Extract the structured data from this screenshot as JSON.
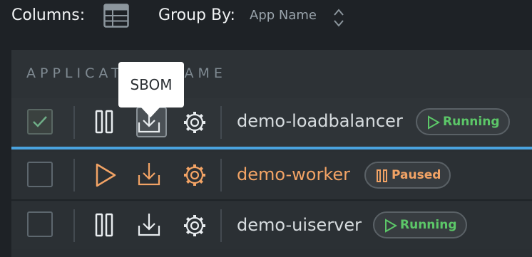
{
  "toolbar": {
    "columns_label": "Columns:",
    "columns_icon": "table-columns-icon",
    "group_by_label": "Group By:",
    "group_by_value": "App Name",
    "group_by_icon": "sort-updown-icon"
  },
  "table": {
    "header_label": "APPLICATION NAME",
    "rows": [
      {
        "name": "demo-loadbalancer",
        "checked": true,
        "action_icon": "pause-icon",
        "status": "Running",
        "status_icon": "play-icon",
        "status_color": "#5cc768",
        "name_color": "#d7dcdf"
      },
      {
        "name": "demo-worker",
        "checked": false,
        "action_icon": "play-icon",
        "status": "Paused",
        "status_icon": "pause-icon",
        "status_color": "#f2a365",
        "name_color": "#f2a365"
      },
      {
        "name": "demo-uiserver",
        "checked": false,
        "action_icon": "pause-icon",
        "status": "Running",
        "status_icon": "play-icon",
        "status_color": "#5cc768",
        "name_color": "#d7dcdf"
      }
    ]
  },
  "tooltip": {
    "text": "SBOM"
  },
  "colors": {
    "background": "#1e2226",
    "selection_accent": "#4aa3df",
    "running": "#5cc768",
    "paused": "#f2a365"
  }
}
